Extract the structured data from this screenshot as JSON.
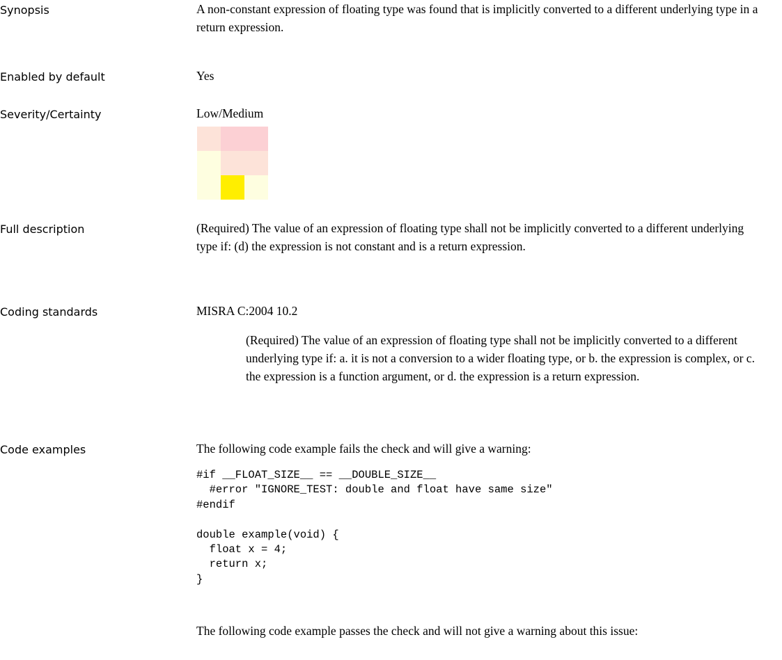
{
  "synopsis": {
    "label": "Synopsis",
    "text": "A non-constant expression of floating type was found that is implicitly converted to a different underlying type in a return expression."
  },
  "enabled": {
    "label": "Enabled by default",
    "value": "Yes"
  },
  "severity": {
    "label": "Severity/Certainty",
    "value": "Low/Medium",
    "matrix_colors": [
      [
        "#fde3d9",
        "#fcd0d4",
        "#fcd0d4"
      ],
      [
        "#fefee0",
        "#fde3d9",
        "#fde3d9"
      ],
      [
        "#fefee0",
        "#ffee00",
        "#fefee0"
      ]
    ]
  },
  "full_description": {
    "label": "Full description",
    "text": "(Required) The value of an expression of floating type shall not be implicitly converted to a different underlying type if: (d) the expression is not constant and is a return expression."
  },
  "coding_standards": {
    "label": "Coding standards",
    "standard": "MISRA C:2004 10.2",
    "text": "(Required) The value of an expression of floating type shall not be implicitly converted to a different underlying type if: a. it is not a conversion to a wider floating type, or b. the expression is complex, or c. the expression is a function argument, or d. the expression is a return expression."
  },
  "code_examples": {
    "label": "Code examples",
    "fail_intro": "The following code example fails the check and will give a warning:",
    "fail_code": "#if __FLOAT_SIZE__ == __DOUBLE_SIZE__\n  #error \"IGNORE_TEST: double and float have same size\"\n#endif\n\ndouble example(void) {\n  float x = 4;\n  return x;\n}",
    "pass_intro": "The following code example passes the check and will not give a warning about this issue:"
  }
}
